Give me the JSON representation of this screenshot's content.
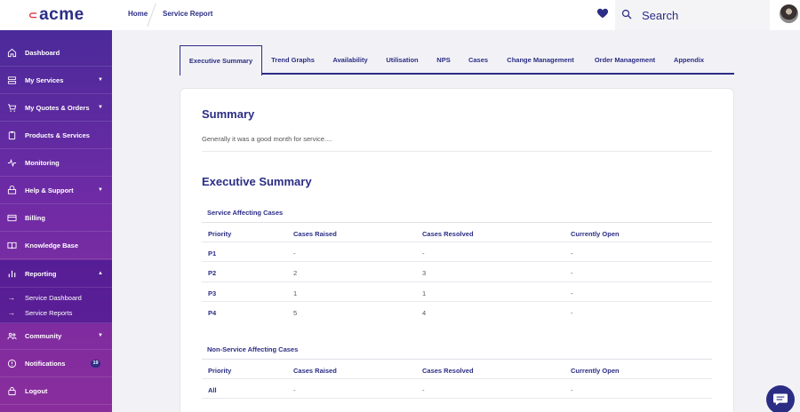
{
  "header": {
    "logo_text": "acme",
    "breadcrumb": {
      "home": "Home",
      "current": "Service Report"
    },
    "search": {
      "placeholder": "Search"
    }
  },
  "sidebar": {
    "items": [
      {
        "label": "Dashboard",
        "icon": "home-icon",
        "chevron": ""
      },
      {
        "label": "My Services",
        "icon": "server-icon",
        "chevron": "▼"
      },
      {
        "label": "My Quotes & Orders",
        "icon": "cart-icon",
        "chevron": "▼"
      },
      {
        "label": "Products & Services",
        "icon": "clipboard-icon",
        "chevron": ""
      },
      {
        "label": "Monitoring",
        "icon": "pulse-icon",
        "chevron": ""
      },
      {
        "label": "Help & Support",
        "icon": "support-icon",
        "chevron": "▼"
      },
      {
        "label": "Billing",
        "icon": "card-icon",
        "chevron": ""
      },
      {
        "label": "Knowledge Base",
        "icon": "book-icon",
        "chevron": ""
      },
      {
        "label": "Reporting",
        "icon": "bar-chart-icon",
        "chevron": "▲"
      },
      {
        "label": "Community",
        "icon": "users-icon",
        "chevron": "▼"
      },
      {
        "label": "Notifications",
        "icon": "bell-icon",
        "badge": "19"
      },
      {
        "label": "Logout",
        "icon": "lock-icon",
        "chevron": ""
      }
    ],
    "reporting_sub": [
      {
        "label": "Service Dashboard"
      },
      {
        "label": "Service Reports"
      }
    ]
  },
  "tabs": [
    {
      "label": "Executive Summary",
      "active": true
    },
    {
      "label": "Trend Graphs"
    },
    {
      "label": "Availability"
    },
    {
      "label": "Utilisation"
    },
    {
      "label": "NPS"
    },
    {
      "label": "Cases"
    },
    {
      "label": "Change Management"
    },
    {
      "label": "Order Management"
    },
    {
      "label": "Appendix"
    }
  ],
  "summary": {
    "title": "Summary",
    "text": "Generally it was a good month for service...."
  },
  "exec": {
    "title": "Executive Summary",
    "affecting": {
      "title": "Service Affecting Cases",
      "headers": [
        "Priority",
        "Cases Raised",
        "Cases Resolved",
        "Currently Open"
      ],
      "rows": [
        [
          "P1",
          "-",
          "-",
          "-"
        ],
        [
          "P2",
          "2",
          "3",
          "-"
        ],
        [
          "P3",
          "1",
          "1",
          "-"
        ],
        [
          "P4",
          "5",
          "4",
          "-"
        ]
      ]
    },
    "non_affecting": {
      "title": "Non-Service Affecting Cases",
      "headers": [
        "Priority",
        "Cases Raised",
        "Cases Resolved",
        "Currently Open"
      ],
      "rows": [
        [
          "All",
          "-",
          "-",
          "-"
        ]
      ]
    }
  },
  "colors": {
    "brand": "#2b2d84",
    "accent": "#e2384b",
    "sidebar_top": "#4b2a9a",
    "sidebar_bottom": "#8a2d9c"
  }
}
